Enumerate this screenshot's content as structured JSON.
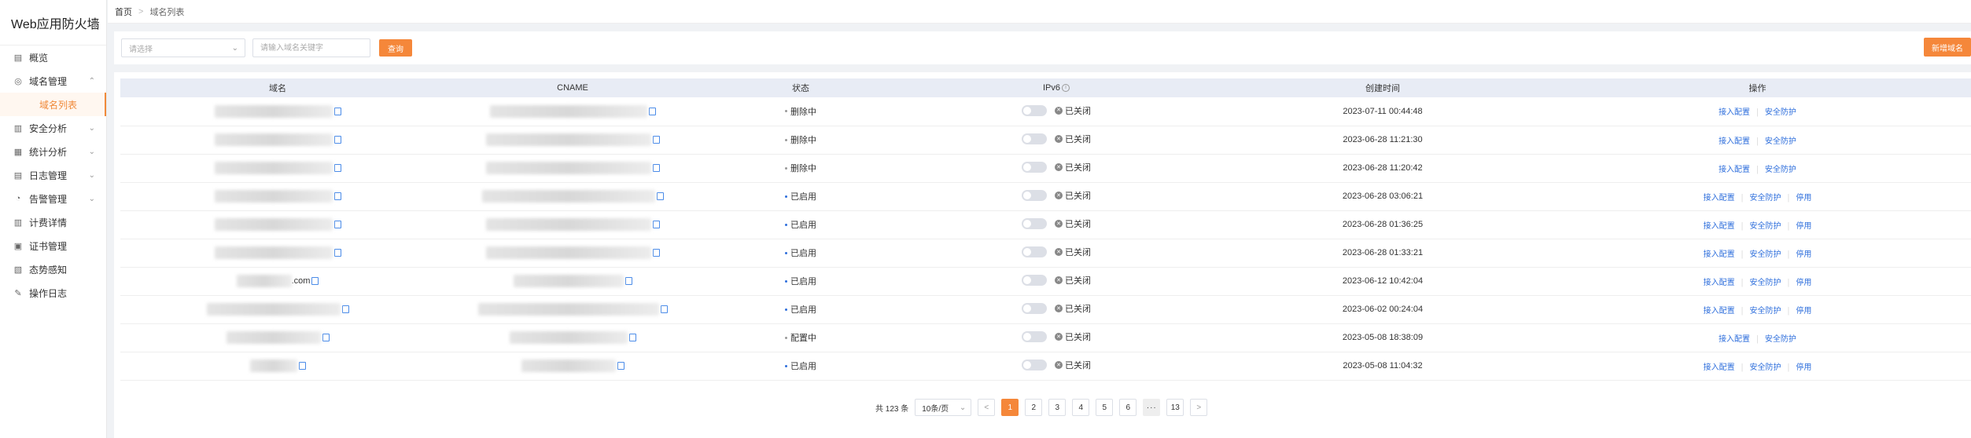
{
  "app_title": "Web应用防火墙",
  "sidebar": {
    "items": [
      {
        "label": "概览",
        "icon": "overview-icon",
        "expandable": false
      },
      {
        "label": "域名管理",
        "icon": "globe-icon",
        "expandable": true,
        "expanded": true
      },
      {
        "label": "域名列表",
        "sub": true,
        "active": true
      },
      {
        "label": "安全分析",
        "icon": "chart-icon",
        "expandable": true
      },
      {
        "label": "统计分析",
        "icon": "stats-icon",
        "expandable": true
      },
      {
        "label": "日志管理",
        "icon": "log-icon",
        "expandable": true
      },
      {
        "label": "告警管理",
        "icon": "alert-icon",
        "expandable": true
      },
      {
        "label": "计费详情",
        "icon": "billing-icon",
        "expandable": false
      },
      {
        "label": "证书管理",
        "icon": "certificate-icon",
        "expandable": false
      },
      {
        "label": "态势感知",
        "icon": "situation-icon",
        "expandable": false
      },
      {
        "label": "操作日志",
        "icon": "edit-log-icon",
        "expandable": false
      }
    ]
  },
  "breadcrumb": {
    "home": "首页",
    "current": "域名列表"
  },
  "filter": {
    "select_placeholder": "请选择",
    "search_placeholder": "请输入域名关键字",
    "search_button": "查询",
    "add_button": "新增域名"
  },
  "table": {
    "headers": [
      "域名",
      "CNAME",
      "状态",
      "IPv6",
      "创建时间",
      "操作"
    ],
    "rows": [
      {
        "domain_suffix": "",
        "status": "删除中",
        "status_color": "#999999",
        "ipv6": "已关闭",
        "created": "2023-07-11 00:44:48",
        "ops": [
          "接入配置",
          "安全防护"
        ]
      },
      {
        "domain_suffix": "",
        "status": "删除中",
        "status_color": "#999999",
        "ipv6": "已关闭",
        "created": "2023-06-28 11:21:30",
        "ops": [
          "接入配置",
          "安全防护"
        ]
      },
      {
        "domain_suffix": "",
        "status": "删除中",
        "status_color": "#999999",
        "ipv6": "已关闭",
        "created": "2023-06-28 11:20:42",
        "ops": [
          "接入配置",
          "安全防护"
        ]
      },
      {
        "domain_suffix": "",
        "status": "已启用",
        "status_color": "#2f6fdc",
        "ipv6": "已关闭",
        "created": "2023-06-28 03:06:21",
        "ops": [
          "接入配置",
          "安全防护",
          "停用"
        ]
      },
      {
        "domain_suffix": "",
        "status": "已启用",
        "status_color": "#2f6fdc",
        "ipv6": "已关闭",
        "created": "2023-06-28 01:36:25",
        "ops": [
          "接入配置",
          "安全防护",
          "停用"
        ]
      },
      {
        "domain_suffix": "",
        "status": "已启用",
        "status_color": "#2f6fdc",
        "ipv6": "已关闭",
        "created": "2023-06-28 01:33:21",
        "ops": [
          "接入配置",
          "安全防护",
          "停用"
        ]
      },
      {
        "domain_suffix": ".com",
        "status": "已启用",
        "status_color": "#2f6fdc",
        "ipv6": "已关闭",
        "created": "2023-06-12 10:42:04",
        "ops": [
          "接入配置",
          "安全防护",
          "停用"
        ]
      },
      {
        "domain_suffix": "",
        "status": "已启用",
        "status_color": "#2f6fdc",
        "ipv6": "已关闭",
        "created": "2023-06-02 00:24:04",
        "ops": [
          "接入配置",
          "安全防护",
          "停用"
        ]
      },
      {
        "domain_suffix": "",
        "status": "配置中",
        "status_color": "#999999",
        "ipv6": "已关闭",
        "created": "2023-05-08 18:38:09",
        "ops": [
          "接入配置",
          "安全防护"
        ]
      },
      {
        "domain_suffix": "",
        "status": "已启用",
        "status_color": "#2f6fdc",
        "ipv6": "已关闭",
        "created": "2023-05-08 11:04:32",
        "ops": [
          "接入配置",
          "安全防护",
          "停用"
        ]
      }
    ]
  },
  "pagination": {
    "total_text": "共 123 条",
    "page_size": "10条/页",
    "pages": [
      "1",
      "2",
      "3",
      "4",
      "5",
      "6",
      "···",
      "13"
    ],
    "current": "1"
  },
  "colors": {
    "accent": "#f5873a",
    "link": "#2f6fdc",
    "header_bg": "#e8ecf5"
  }
}
